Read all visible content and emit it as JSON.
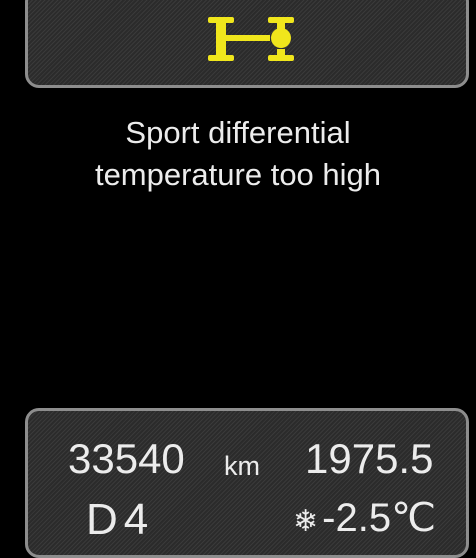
{
  "warning": {
    "icon": "differential-icon",
    "icon_color": "#f0e61c",
    "message_line1": "Sport differential",
    "message_line2": "temperature too high"
  },
  "info": {
    "odometer": "33540",
    "odometer_unit": "km",
    "trip": "1975.5",
    "gear": "D4",
    "outside_icon": "snowflake-icon",
    "outside_temp": "-2.5℃"
  },
  "colors": {
    "background": "#000000",
    "panel_border": "#8d8d8d",
    "text": "#ececec"
  }
}
